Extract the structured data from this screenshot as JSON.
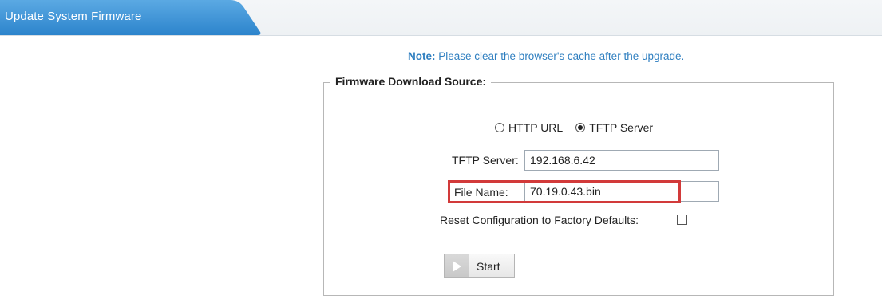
{
  "header": {
    "title": "Update System Firmware"
  },
  "note": {
    "prefix": "Note:",
    "text": " Please clear the browser's cache after the upgrade."
  },
  "firmware": {
    "legend": "Firmware Download Source:",
    "radio_http": "HTTP URL",
    "radio_tftp": "TFTP Server",
    "selected_source": "TFTP Server",
    "tftp_label": "TFTP Server:",
    "tftp_value": "192.168.6.42",
    "file_label": "File Name:",
    "file_value": "70.19.0.43.bin",
    "reset_label": "Reset Configuration to Factory Defaults:",
    "reset_checked": false,
    "start_label": "Start"
  },
  "colors": {
    "accent": "#2f7fc0",
    "highlight": "#d23a3a"
  }
}
